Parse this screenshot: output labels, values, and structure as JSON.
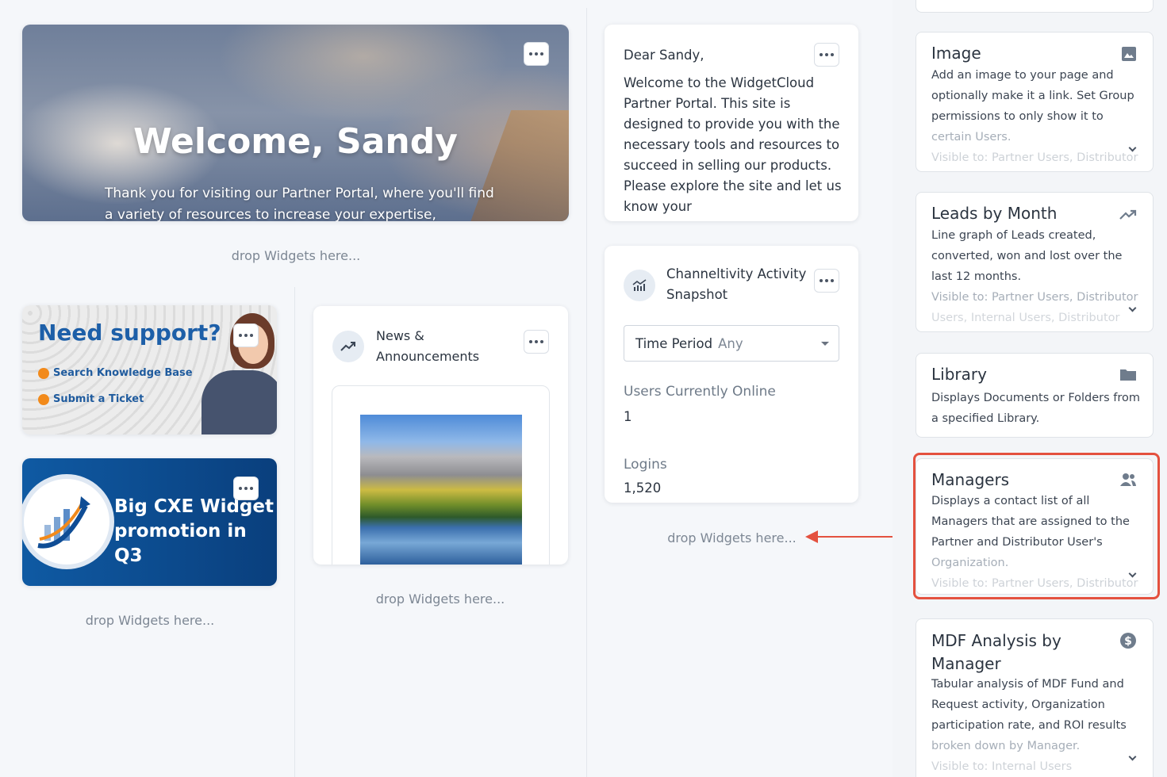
{
  "hero": {
    "title": "Welcome, Sandy",
    "subtitle": "Thank you for visiting our Partner Portal, where you'll find a variety of resources to increase your expertise,"
  },
  "drop_label": "drop Widgets here...",
  "support": {
    "title": "Need support?",
    "links": [
      "Search Knowledge Base",
      "Submit a Ticket"
    ]
  },
  "promo": {
    "line1": "Big CXE Widget",
    "line2": "promotion in Q3"
  },
  "news": {
    "title_line1": "News &",
    "title_line2": "Announcements",
    "icon": "trending-up-icon"
  },
  "letter": {
    "greeting": "Dear Sandy,",
    "body": "Welcome to the WidgetCloud Partner Portal. This site is designed to provide you with the necessary tools and resources to succeed in selling our products. Please explore the site and let us know your"
  },
  "activity": {
    "title_line1": "Channeltivity Activity",
    "title_line2": "Snapshot",
    "icon": "analytics-icon",
    "time_period_label": "Time Period",
    "time_period_value": "Any",
    "users_online_label": "Users Currently Online",
    "users_online_value": "1",
    "logins_label": "Logins",
    "logins_value": "1,520"
  },
  "widgets": [
    {
      "title": "Image",
      "icon": "image-icon",
      "desc": "Add an image to your page and optionally make it a link. Set Group permissions to only show it to",
      "desc_fade": "certain Users.",
      "visible": "Visible to: Partner Users, Distributor"
    },
    {
      "title": "Leads by Month",
      "icon": "trending-up-icon",
      "desc": "Line graph of Leads created, converted, won and lost over the last 12 months.",
      "visible": "Visible to: Partner Users, Distributor",
      "visible2": "Users, Internal Users, Distributor"
    },
    {
      "title": "Library",
      "icon": "folder-icon",
      "desc": "Displays Documents or Folders from a specified Library."
    },
    {
      "title": "Managers",
      "icon": "users-icon",
      "desc": "Displays a contact list of all Managers that are assigned to the Partner and Distributor User's",
      "desc_fade": "Organization.",
      "visible": "Visible to: Partner Users, Distributor"
    },
    {
      "title": "MDF Analysis by Manager",
      "icon": "dollar-icon",
      "desc": "Tabular analysis of MDF Fund and Request activity, Organization participation rate, and ROI results",
      "desc_fade": "broken down by Manager.",
      "visible": "Visible to: Internal Users"
    }
  ],
  "colors": {
    "accent_red": "#e4513f",
    "brand_blue": "#1d5fa8",
    "orange": "#f28a1b"
  }
}
